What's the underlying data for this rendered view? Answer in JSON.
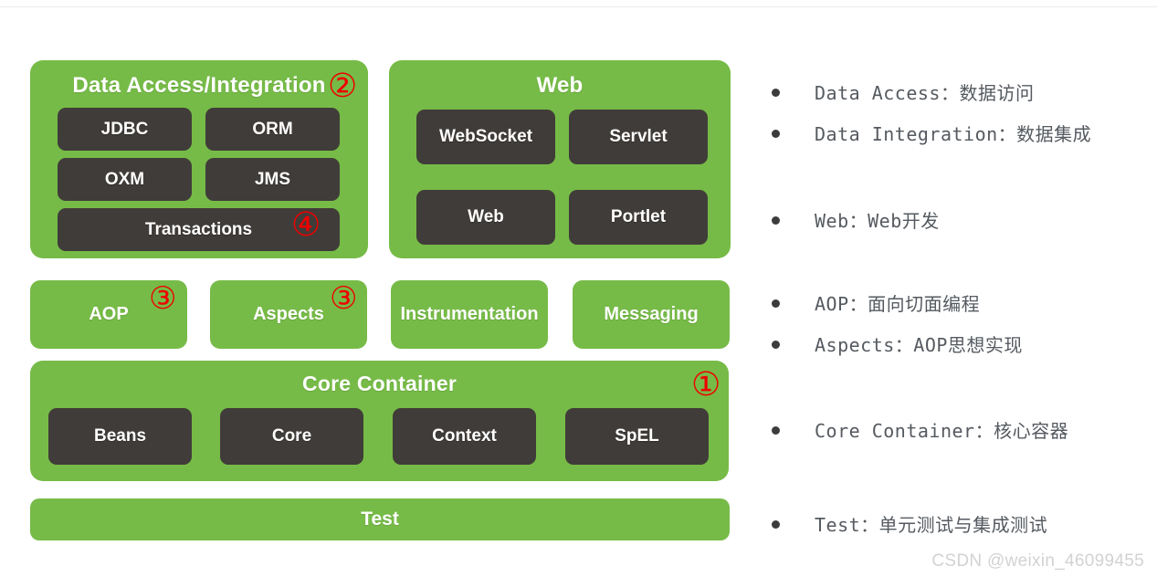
{
  "colors": {
    "green": "#76bb47",
    "dark": "#403c39",
    "marker_red": "#ee0000",
    "note_text": "#555a60",
    "background": "#ffffff"
  },
  "diagram": {
    "data_access_panel": {
      "title": "Data Access/Integration",
      "marker": "②",
      "modules": [
        {
          "label": "JDBC"
        },
        {
          "label": "ORM"
        },
        {
          "label": "OXM"
        },
        {
          "label": "JMS"
        },
        {
          "label": "Transactions",
          "marker": "④"
        }
      ]
    },
    "web_panel": {
      "title": "Web",
      "modules": [
        {
          "label": "WebSocket"
        },
        {
          "label": "Servlet"
        },
        {
          "label": "Web"
        },
        {
          "label": "Portlet"
        }
      ]
    },
    "middle_row": [
      {
        "label": "AOP",
        "marker": "③"
      },
      {
        "label": "Aspects",
        "marker": "③"
      },
      {
        "label": "Instrumentation"
      },
      {
        "label": "Messaging"
      }
    ],
    "core_container_panel": {
      "title": "Core Container",
      "marker": "①",
      "modules": [
        {
          "label": "Beans"
        },
        {
          "label": "Core"
        },
        {
          "label": "Context"
        },
        {
          "label": "SpEL"
        }
      ]
    },
    "test_bar": {
      "label": "Test"
    }
  },
  "notes": [
    {
      "text": "Data Access：数据访问"
    },
    {
      "text": "Data Integration：数据集成"
    },
    {
      "text": "Web：Web开发"
    },
    {
      "text": "AOP：面向切面编程"
    },
    {
      "text": "Aspects：AOP思想实现"
    },
    {
      "text": "Core Container：核心容器"
    },
    {
      "text": "Test：单元测试与集成测试"
    }
  ],
  "watermark": "CSDN @weixin_46099455"
}
